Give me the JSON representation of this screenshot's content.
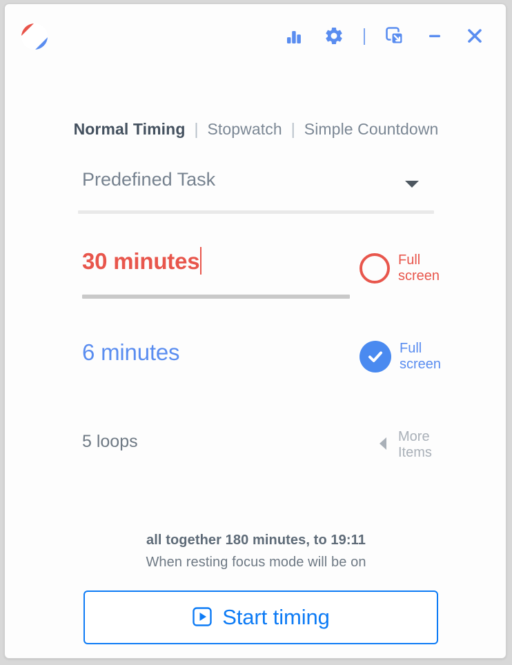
{
  "window": {
    "titlebar": {
      "logo_icon": "app-logo-icon",
      "actions": [
        {
          "name": "statistics-button",
          "icon": "bar-chart-icon",
          "label": "Statistics"
        },
        {
          "name": "settings-button",
          "icon": "gear-icon",
          "label": "Settings"
        },
        {
          "name": "titlebar-divider",
          "icon": "divider",
          "label": "|"
        },
        {
          "name": "mini-window-button",
          "icon": "mini-window-icon",
          "label": "Mini window"
        },
        {
          "name": "minimize-button",
          "icon": "minimize-icon",
          "label": "Minimize"
        },
        {
          "name": "close-button",
          "icon": "close-icon",
          "label": "Close"
        }
      ]
    }
  },
  "tabs": [
    {
      "label": "Normal Timing",
      "active": true
    },
    {
      "label": "Stopwatch",
      "active": false
    },
    {
      "label": "Simple Countdown",
      "active": false
    }
  ],
  "tab_divider": "|",
  "task_select": {
    "value": "Predefined Task",
    "caret_icon": "chevron-down-icon"
  },
  "focus": {
    "value": "30 minutes",
    "fullscreen_label": "Full\nscreen",
    "fullscreen_checked": false,
    "color": "#e8564c"
  },
  "rest": {
    "value": "6 minutes",
    "fullscreen_label": "Full\nscreen",
    "fullscreen_checked": true,
    "color": "#5a8df0"
  },
  "loops": {
    "value": "5 loops",
    "more_items_label": "More\nItems",
    "more_items_caret_icon": "chevron-left-icon"
  },
  "summary": {
    "main": "all together 180 minutes, to 19:11",
    "sub": "When resting focus mode will be on"
  },
  "start": {
    "label": "Start timing",
    "icon": "play-square-icon",
    "color": "#0d7bf5"
  }
}
